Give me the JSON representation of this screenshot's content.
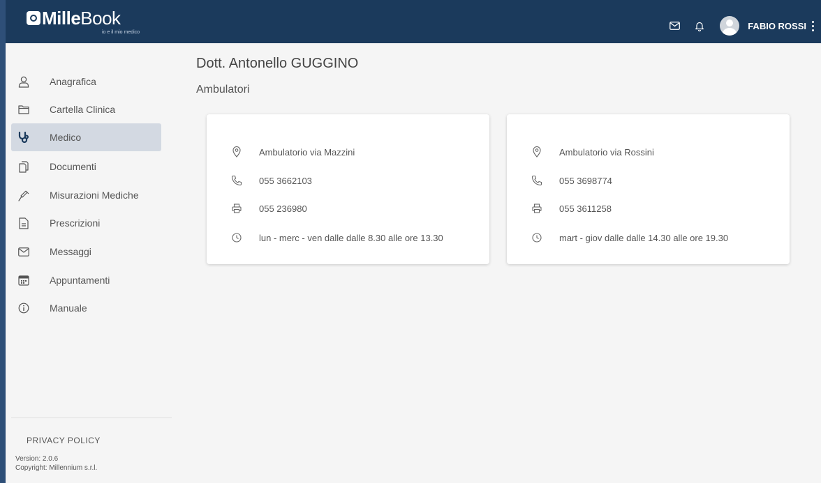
{
  "app": {
    "logo_bold": "Mille",
    "logo_light": "Book",
    "logo_tagline": "io e il mio medico"
  },
  "header": {
    "user_name": "FABIO ROSSI",
    "icons": [
      "mail-icon",
      "bell-icon",
      "avatar",
      "kebab-menu-icon"
    ]
  },
  "sidebar": {
    "items": [
      {
        "label": "Anagrafica",
        "icon": "user-icon",
        "active": false
      },
      {
        "label": "Cartella Clinica",
        "icon": "folder-icon",
        "active": false
      },
      {
        "label": "Medico",
        "icon": "stethoscope-icon",
        "active": true
      },
      {
        "label": "Documenti",
        "icon": "documents-icon",
        "active": false
      },
      {
        "label": "Misurazioni Mediche",
        "icon": "syringe-icon",
        "active": false
      },
      {
        "label": "Prescrizioni",
        "icon": "prescription-icon",
        "active": false
      },
      {
        "label": "Messaggi",
        "icon": "mail-icon",
        "active": false
      },
      {
        "label": "Appuntamenti",
        "icon": "calendar-icon",
        "active": false
      },
      {
        "label": "Manuale",
        "icon": "info-icon",
        "active": false
      }
    ],
    "privacy_label": "PRIVACY POLICY",
    "version": "Version: 2.0.6",
    "copyright": "Copyright: Millennium s.r.l."
  },
  "main": {
    "doctor_name": "Dott. Antonello GUGGINO",
    "section_title": "Ambulatori",
    "clinics": [
      {
        "name": "Ambulatorio via Mazzini",
        "phone": "055 3662103",
        "fax": "055 236980",
        "hours": "lun - merc - ven dalle dalle 8.30 alle ore 13.30"
      },
      {
        "name": "Ambulatorio via Rossini",
        "phone": "055 3698774",
        "fax": "055 3611258",
        "hours": "mart - giov dalle dalle 14.30 alle ore 19.30"
      }
    ]
  },
  "colors": {
    "header_bg": "#1b3a5c",
    "active_nav_bg": "#d3d9e2",
    "page_bg": "#f5f5f5"
  }
}
